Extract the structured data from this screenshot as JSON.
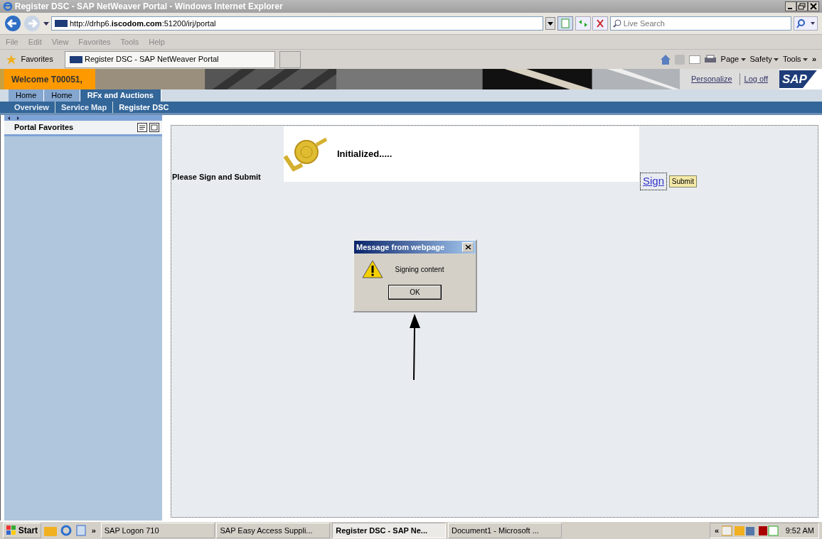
{
  "window": {
    "title": "Register DSC - SAP NetWeaver Portal - Windows Internet Explorer"
  },
  "address_bar": {
    "url": "http://drhp6.**iscodom.com**:51200/irj/portal",
    "search": {
      "placeholder": "Live Search"
    }
  },
  "menu": [
    "File",
    "Edit",
    "View",
    "Favorites",
    "Tools",
    "Help"
  ],
  "favorites_bar": {
    "label": "Favorites",
    "tab": "Register DSC - SAP NetWeaver Portal",
    "commands": [
      "Page",
      "Safety",
      "Tools"
    ],
    "more": "»"
  },
  "portal_header": {
    "welcome": "Welcome T00051,",
    "links": [
      "Personalize",
      "Log off"
    ],
    "logo": "SAP"
  },
  "tabs": [
    {
      "label": "Home",
      "selected": false
    },
    {
      "label": "Home",
      "selected": false
    },
    {
      "label": "RFx and Auctions",
      "selected": true
    }
  ],
  "sub_nav": [
    {
      "label": "Overview",
      "selected": false
    },
    {
      "label": "Service Map",
      "selected": false
    },
    {
      "label": "Register DSC",
      "selected": true
    }
  ],
  "sidebar": {
    "title": "Portal Favorites"
  },
  "content": {
    "status": "Initialized.....",
    "prompt": "Please Sign and Submit",
    "sign_link": "Sign",
    "submit_button": "Submit"
  },
  "dialog": {
    "title": "Message from webpage",
    "message": "Signing content",
    "button": "OK"
  },
  "taskbar": {
    "start": "Start",
    "more": "»",
    "items": [
      {
        "label": "SAP Logon 710",
        "selected": false
      },
      {
        "label": "SAP Easy Access  Suppli...",
        "selected": false
      },
      {
        "label": "Register DSC - SAP Ne...",
        "selected": true
      },
      {
        "label": "Document1 - Microsoft ...",
        "selected": false
      }
    ],
    "tray_toggle": "«",
    "clock": "9:52 AM"
  }
}
